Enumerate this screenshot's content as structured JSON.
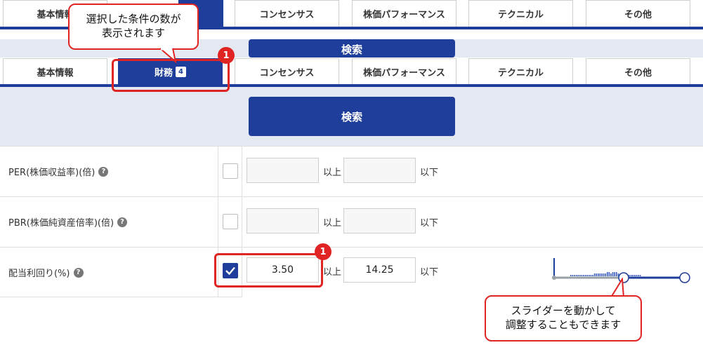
{
  "tabs": [
    {
      "label": "基本情報"
    },
    {
      "label": "財務",
      "badge": "4"
    },
    {
      "label": "コンセンサス"
    },
    {
      "label": "株価パフォーマンス"
    },
    {
      "label": "テクニカル"
    },
    {
      "label": "その他"
    }
  ],
  "search_label": "検索",
  "rows": [
    {
      "label": "PER(株価収益率)(倍)",
      "min": "",
      "max": "",
      "checked": false
    },
    {
      "label": "PBR(株価純資産倍率)(倍)",
      "min": "",
      "max": "",
      "checked": false
    },
    {
      "label": "配当利回り(%)",
      "min": "3.50",
      "max": "14.25",
      "checked": true
    }
  ],
  "units": {
    "above": "以上",
    "below": "以下"
  },
  "help_glyph": "?",
  "slider": {
    "min_value": "3.50",
    "max_value": "14.25"
  },
  "callouts": {
    "tab_count_line1": "選択した条件の数が",
    "tab_count_line2": "表示されます",
    "slider_line1": "スライダーを動かして",
    "slider_line2": "調整することもできます",
    "number": "1"
  },
  "colors": {
    "brand": "#1f3d9a",
    "accent": "#e02424",
    "band": "#e4e9f1"
  }
}
